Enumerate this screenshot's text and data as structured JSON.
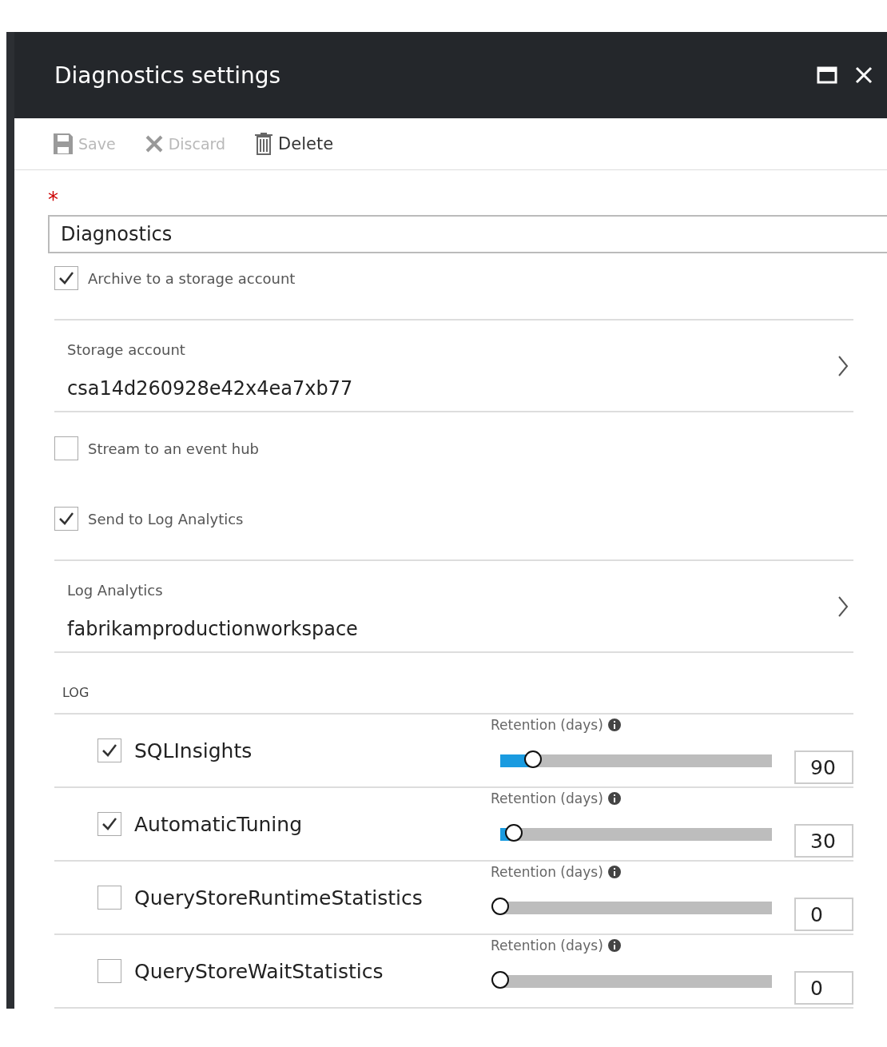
{
  "window": {
    "title": "Diagnostics settings"
  },
  "toolbar": [
    {
      "kind": "save",
      "label": "Save",
      "disabled": true
    },
    {
      "kind": "discard",
      "label": "Discard",
      "disabled": true
    },
    {
      "kind": "delete",
      "label": "Delete",
      "disabled": false
    }
  ],
  "name_field": {
    "required": true,
    "required_mark": "*",
    "value": "Diagnostics"
  },
  "destinations": [
    {
      "kind": "option",
      "label": "Archive to a storage account",
      "checked": true
    },
    {
      "kind": "picker",
      "label": "Storage account",
      "value": "csa14d260928e42x4ea7xb77"
    },
    {
      "kind": "option",
      "label": "Stream to an event hub",
      "checked": false
    },
    {
      "kind": "option",
      "label": "Send to Log Analytics",
      "checked": true
    },
    {
      "kind": "picker",
      "label": "Log Analytics",
      "value": "fabrikamproductionworkspace"
    }
  ],
  "log": {
    "heading": "LOG",
    "categories": [
      {
        "name": "SQLInsights",
        "checked": true,
        "retention_label": "Retention (days)",
        "level": 0.12,
        "days": "90"
      },
      {
        "name": "AutomaticTuning",
        "checked": true,
        "retention_label": "Retention (days)",
        "level": 0.05,
        "days": "30"
      },
      {
        "name": "QueryStoreRuntimeStatistics",
        "checked": false,
        "retention_label": "Retention (days)",
        "level": 0,
        "days": "0"
      },
      {
        "name": "QueryStoreWaitStatistics",
        "checked": false,
        "retention_label": "Retention (days)",
        "level": 0,
        "days": "0"
      }
    ]
  }
}
